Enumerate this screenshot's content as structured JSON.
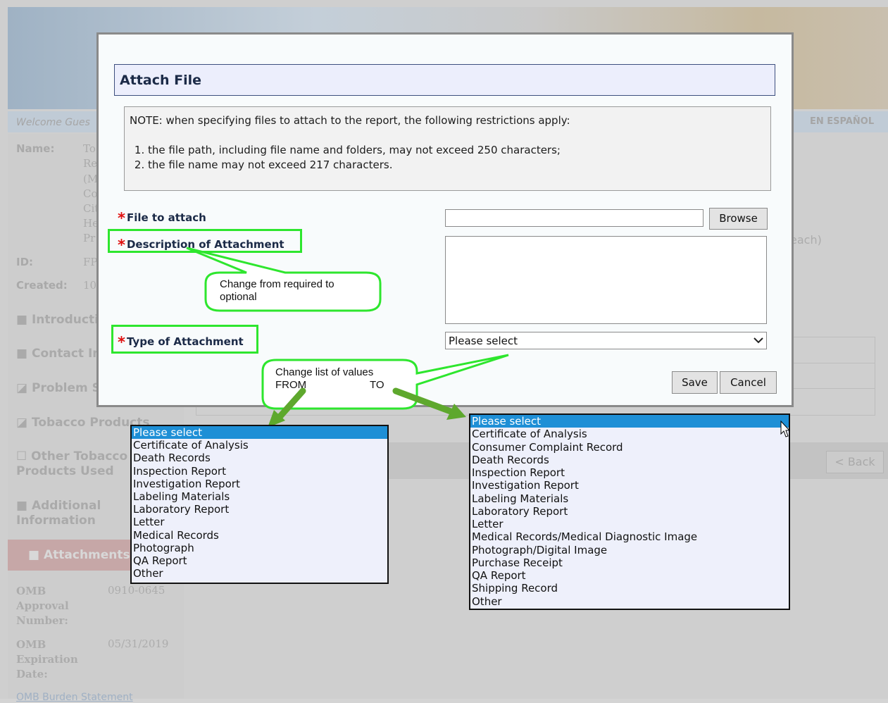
{
  "background": {
    "welcome_text": "Welcome Gues",
    "espanol_label": "EN ESPAÑOL",
    "name_label": "Name:",
    "name_fragments": [
      "To",
      "Re",
      "(M",
      "Co",
      "Cit",
      "He",
      "Pr"
    ],
    "id_label": "ID:",
    "id_fragment": "FP",
    "created_label": "Created:",
    "created_fragment": "10",
    "nav_items": [
      "■ Introductio",
      "■ Contact In",
      "◪ Problem S",
      "◪ Tobacco Products",
      "☐ Other Tobacco Products Used",
      "■ Additional Information"
    ],
    "attachments_label": "■ Attachments",
    "omb_approval_label": "OMB Approval Number:",
    "omb_approval_value": "0910-0645",
    "omb_expiration_label": "OMB Expiration Date:",
    "omb_expiration_value": "05/31/2019",
    "omb_burden_link": "OMB Burden Statement",
    "each_fragment": "each)",
    "back_button": "< Back"
  },
  "dialog": {
    "title": "Attach File",
    "note": {
      "intro": "NOTE: when specifying files to attach to the report, the following restrictions apply:",
      "items": [
        "the file path, including file name and folders, may not exceed 250 characters;",
        "the file name may not exceed 217 characters."
      ]
    },
    "required_marker": "*",
    "fields": {
      "file_label": "File to attach",
      "file_value": "",
      "browse_label": "Browse",
      "description_label": "Description of Attachment",
      "description_value": "",
      "type_label": "Type of Attachment",
      "type_selected": "Please select"
    },
    "save_label": "Save",
    "cancel_label": "Cancel"
  },
  "annotations": {
    "callout_description": [
      "Change from required to",
      "optional"
    ],
    "callout_list_title": "Change list of values",
    "callout_from": "FROM",
    "callout_to": "TO",
    "highlight_color": "#2ee62e",
    "arrow_color": "#5ea82d"
  },
  "lists": {
    "from": [
      "Please select",
      "Certificate of Analysis",
      "Death Records",
      "Inspection Report",
      "Investigation Report",
      "Labeling Materials",
      "Laboratory Report",
      "Letter",
      "Medical Records",
      "Photograph",
      "QA Report",
      "Other"
    ],
    "to": [
      "Please select",
      "Certificate of Analysis",
      "Consumer Complaint Record",
      "Death Records",
      "Inspection Report",
      "Investigation Report",
      "Labeling Materials",
      "Laboratory Report",
      "Letter",
      "Medical Records/Medical Diagnostic Image",
      "Photograph/Digital Image",
      "Purchase Receipt",
      "QA Report",
      "Shipping Record",
      "Other"
    ],
    "selected_index": 0,
    "selected_color": "#1e8fd6"
  }
}
